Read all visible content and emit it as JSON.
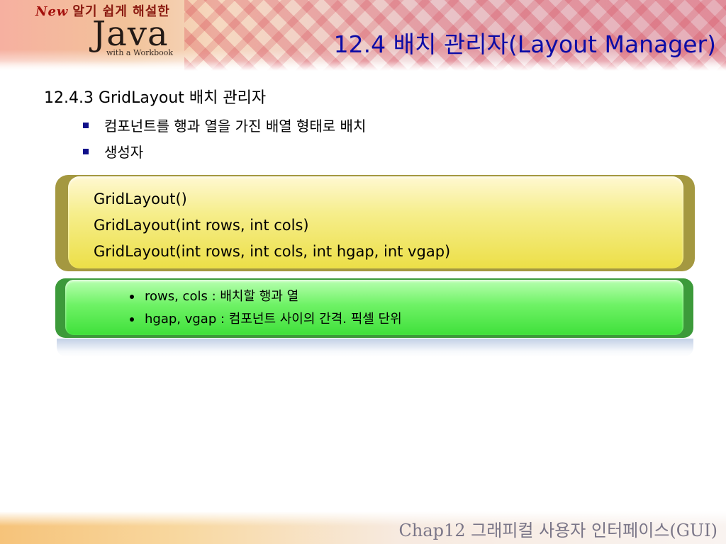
{
  "header": {
    "logo": {
      "new_label": "New",
      "tagline": "알기 쉽게 해설한",
      "brand": "Java",
      "subtitle": "with a Workbook"
    },
    "title": "12.4 배치 관리자(Layout Manager)"
  },
  "content": {
    "section_heading": "12.4.3  GridLayout 배치 관리자",
    "bullets": [
      "컴포넌트를 행과 열을 가진 배열 형태로 배치",
      "생성자"
    ],
    "constructors": [
      "GridLayout()",
      "GridLayout(int rows, int cols)",
      "GridLayout(int rows, int cols, int hgap, int vgap)"
    ],
    "parameters": [
      "rows, cols : 배치할 행과 열",
      "hgap, vgap : 컴포넌트 사이의 간격. 픽셀 단위"
    ]
  },
  "footer": {
    "chapter_label": "Chap12 그래피컬 사용자 인터페이스(GUI)"
  },
  "colors": {
    "title": "#0c0ca6",
    "bullet_square": "#10108a",
    "yellow_panel": "#ecdf47",
    "green_panel": "#3fe03a",
    "footer_text": "#7a7688"
  }
}
